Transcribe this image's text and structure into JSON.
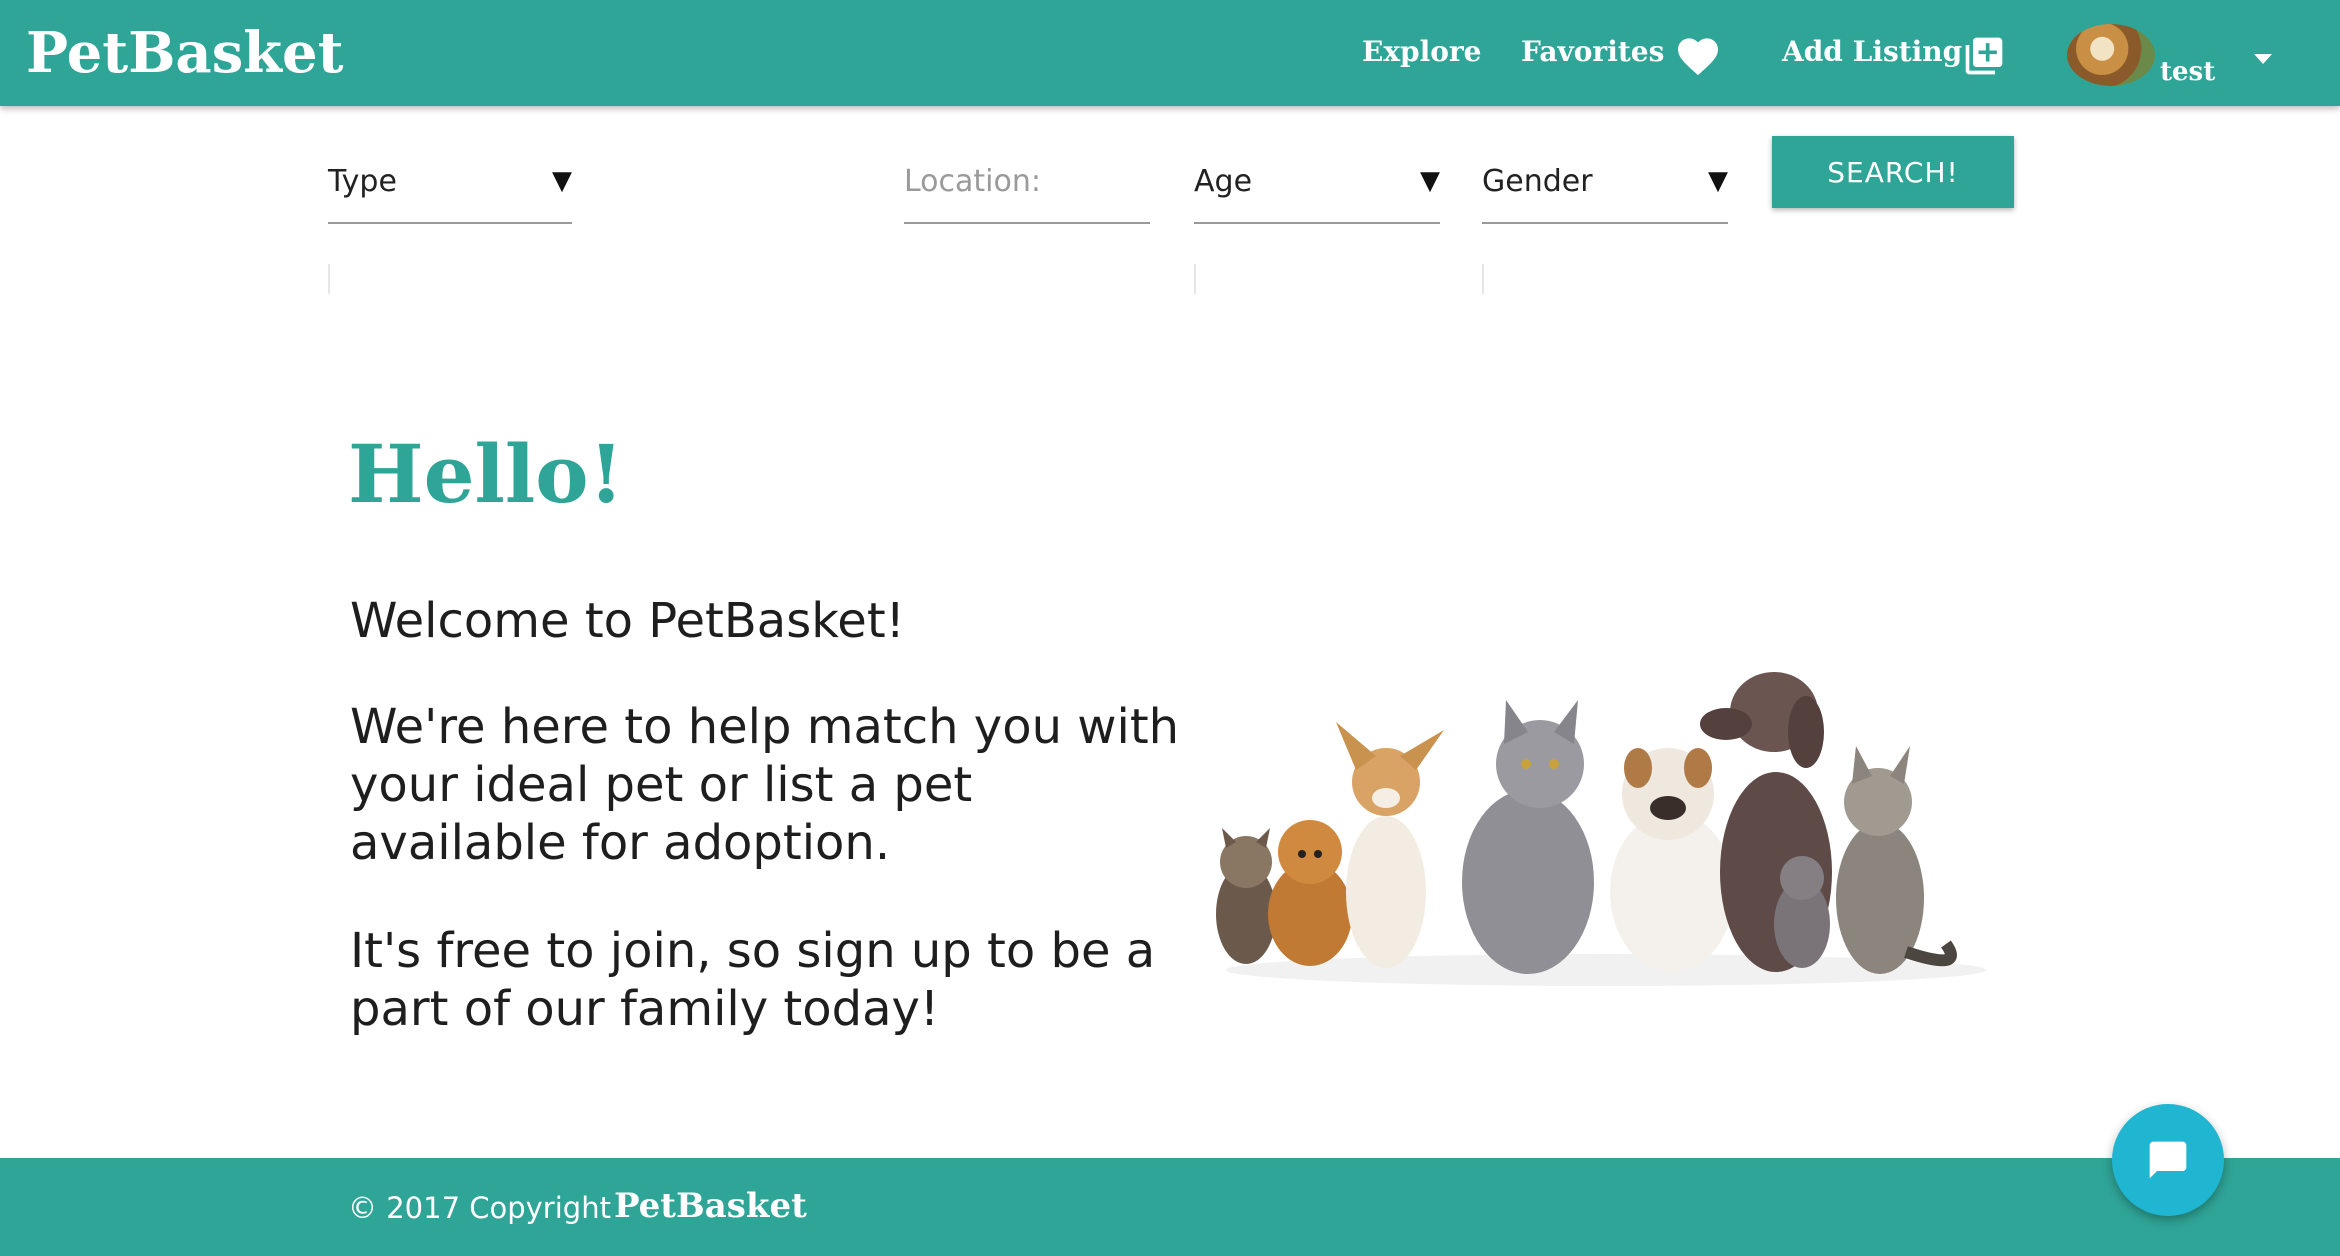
{
  "navbar": {
    "brand": "PetBasket",
    "explore": "Explore",
    "favorites": "Favorites",
    "add_listing": "Add Listing",
    "username": "test",
    "icons": [
      "heart-icon",
      "add-box-icon",
      "chevron-down-icon"
    ]
  },
  "search": {
    "type_label": "Type",
    "location_placeholder": "Location:",
    "location_value": "",
    "age_label": "Age",
    "gender_label": "Gender",
    "button_label": "SEARCH!"
  },
  "hero": {
    "heading": "Hello!",
    "welcome": "Welcome to PetBasket!",
    "intro": "We're here to help match you with your ideal pet or list a pet available for adoption.",
    "join": "It's free to join, so sign up to be a part of our family today!"
  },
  "footer": {
    "copyright": "© 2017 Copyright",
    "brand": "PetBasket"
  },
  "colors": {
    "primary": "#2fa597",
    "chat_button": "#20b5d0",
    "text": "#1e1e1e"
  }
}
